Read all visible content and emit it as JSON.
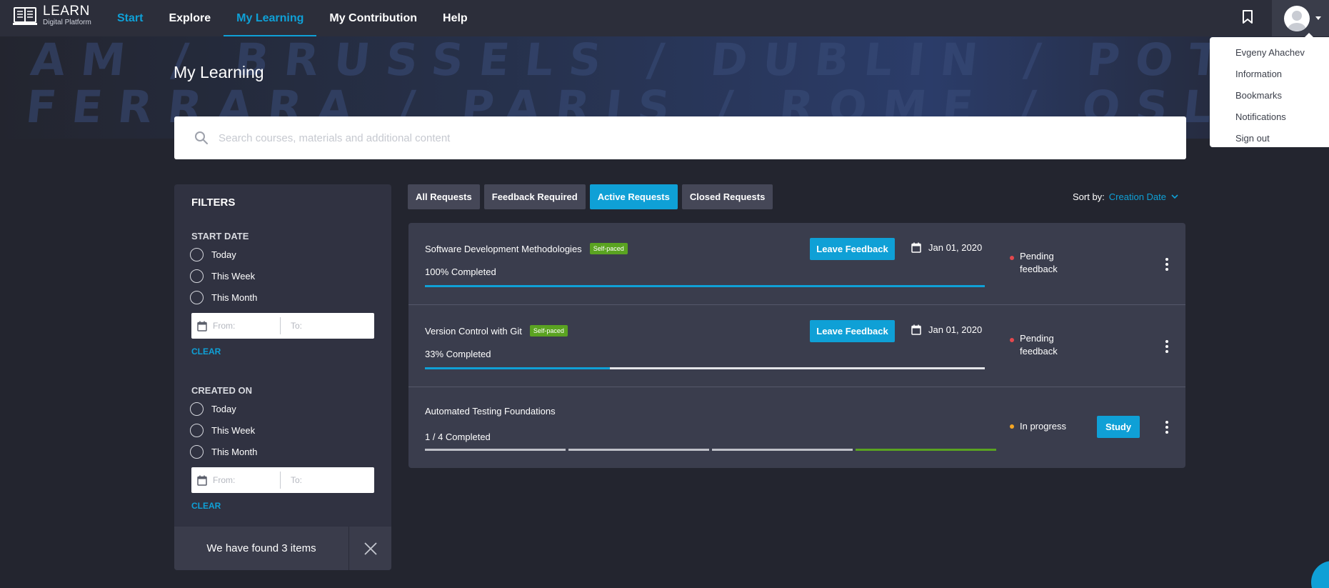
{
  "brand": {
    "title": "LEARN",
    "subtitle": "Digital Platform"
  },
  "nav": {
    "items": [
      {
        "label": "Start"
      },
      {
        "label": "Explore"
      },
      {
        "label": "My Learning"
      },
      {
        "label": "My Contribution"
      },
      {
        "label": "Help"
      }
    ],
    "active": "My Learning"
  },
  "user_menu": {
    "name": "Evgeny Ahachev",
    "items": [
      "Information",
      "Bookmarks",
      "Notifications",
      "Sign out"
    ]
  },
  "hero": {
    "line1": "AM / BRUSSELS / DUBLIN / POTSDAM / BRUSS",
    "line2": "FERRARA / PARIS / ROME / OSLO / FERRARA / P"
  },
  "page": {
    "title": "My Learning"
  },
  "search": {
    "placeholder": "Search courses, materials and additional content"
  },
  "filters": {
    "title": "FILTERS",
    "start_date": {
      "label": "START DATE",
      "options": [
        "Today",
        "This Week",
        "This Month"
      ],
      "from_placeholder": "From:",
      "to_placeholder": "To:",
      "clear": "CLEAR"
    },
    "created_on": {
      "label": "CREATED ON",
      "options": [
        "Today",
        "This Week",
        "This Month"
      ],
      "from_placeholder": "From:",
      "to_placeholder": "To:",
      "clear": "CLEAR"
    },
    "found_text": "We have found 3 items"
  },
  "tabs": {
    "items": [
      "All Requests",
      "Feedback Required",
      "Active Requests",
      "Closed Requests"
    ],
    "active": "Active Requests"
  },
  "sort": {
    "label": "Sort by:",
    "value": "Creation Date"
  },
  "courses": [
    {
      "title": "Software Development Methodologies",
      "badge": "Self-paced",
      "progress_label": "100% Completed",
      "progress": 1.0,
      "action": "Leave Feedback",
      "date": "Jan 01, 2020",
      "status_line1": "Pending",
      "status_line2": "feedback",
      "status_color": "#e5484d"
    },
    {
      "title": "Version Control with Git",
      "badge": "Self-paced",
      "progress_label": "33% Completed",
      "progress": 0.33,
      "action": "Leave Feedback",
      "date": "Jan 01, 2020",
      "status_line1": "Pending",
      "status_line2": "feedback",
      "status_color": "#e5484d"
    },
    {
      "title": "Automated Testing Foundations",
      "progress_label": "1 / 4 Completed",
      "segments_total": 4,
      "segments_completed": 1,
      "status": "In progress",
      "status_color": "#f5a623",
      "action": "Study"
    }
  ],
  "colors": {
    "accent": "#0fa0d6",
    "background": "#23252f",
    "panel": "#303241",
    "card": "#3a3d4d",
    "badge_green": "#5aa321"
  }
}
